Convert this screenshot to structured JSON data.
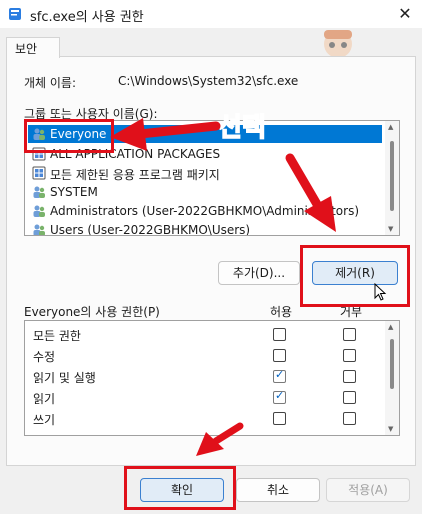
{
  "window": {
    "title": "sfc.exe의 사용 권한",
    "close_glyph": "✕"
  },
  "tab": {
    "label": "보안"
  },
  "object": {
    "label": "개체 이름:",
    "value": "C:\\Windows\\System32\\sfc.exe"
  },
  "groups": {
    "label": "그룹 또는 사용자 이름(G):",
    "items": [
      {
        "label": "Everyone",
        "icon": "user-group-icon",
        "selected": true
      },
      {
        "label": "ALL APPLICATION PACKAGES",
        "icon": "package-icon",
        "selected": false
      },
      {
        "label": "모든 제한된 응용 프로그램 패키지",
        "icon": "package-icon",
        "selected": false
      },
      {
        "label": "SYSTEM",
        "icon": "user-group-icon",
        "selected": false
      },
      {
        "label": "Administrators (User-2022GBHKMO\\Administrators)",
        "icon": "user-group-icon",
        "selected": false
      },
      {
        "label": "Users (User-2022GBHKMO\\Users)",
        "icon": "user-group-icon",
        "selected": false
      }
    ]
  },
  "buttons": {
    "add": "추가(D)...",
    "remove": "제거(R)",
    "ok": "확인",
    "cancel": "취소",
    "apply": "적용(A)"
  },
  "permissions": {
    "label": "Everyone의 사용 권한(P)",
    "allow_header": "허용",
    "deny_header": "거부",
    "rows": [
      {
        "name": "모든 권한",
        "allow": false,
        "deny": false
      },
      {
        "name": "수정",
        "allow": false,
        "deny": false
      },
      {
        "name": "읽기 및 실행",
        "allow": true,
        "deny": false
      },
      {
        "name": "읽기",
        "allow": true,
        "deny": false
      },
      {
        "name": "쓰기",
        "allow": false,
        "deny": false
      }
    ]
  },
  "annotation": {
    "text": "선택",
    "color": "#1550e6",
    "highlight_color": "#e0101a"
  },
  "colors": {
    "selection": "#0078d4",
    "accent_border": "#3b80d0"
  }
}
